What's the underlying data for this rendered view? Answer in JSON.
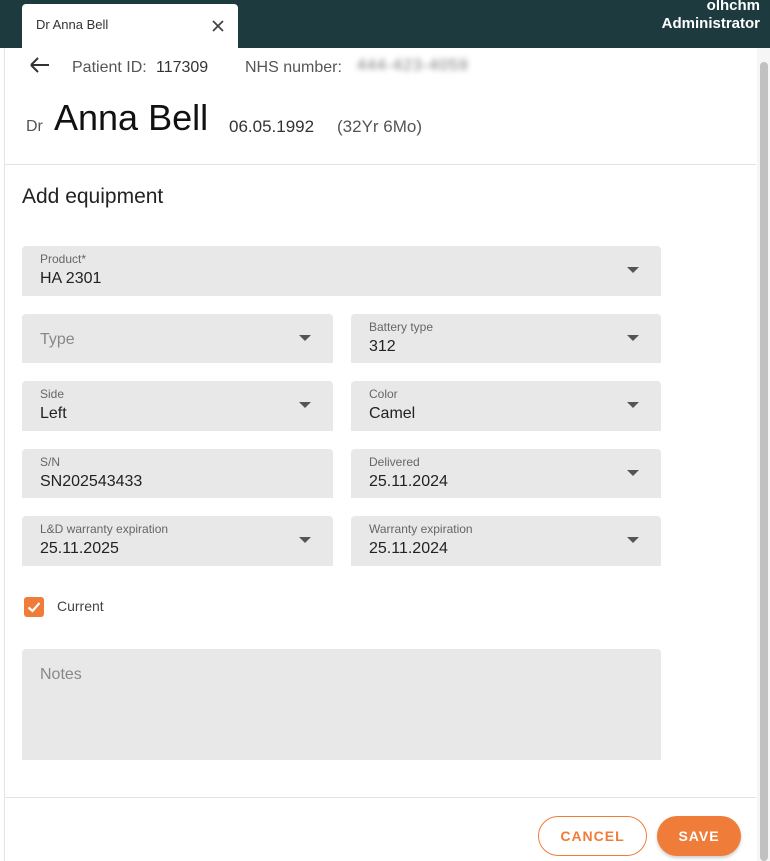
{
  "tab": {
    "label": "Dr Anna Bell"
  },
  "user": {
    "name": "olhchm",
    "role": "Administrator"
  },
  "patient": {
    "id_label": "Patient ID:",
    "id_value": "117309",
    "nhs_label": "NHS number:",
    "nhs_value": "444-423-4059",
    "prefix": "Dr",
    "name": "Anna Bell",
    "dob": "06.05.1992",
    "age": "(32Yr 6Mo)"
  },
  "form": {
    "title": "Add equipment",
    "product": {
      "label": "Product*",
      "value": "HA 2301"
    },
    "type": {
      "placeholder": "Type"
    },
    "battery_type": {
      "label": "Battery type",
      "value": "312"
    },
    "side": {
      "label": "Side",
      "value": "Left"
    },
    "color": {
      "label": "Color",
      "value": "Camel"
    },
    "sn": {
      "label": "S/N",
      "value": "SN202543433"
    },
    "delivered": {
      "label": "Delivered",
      "value": "25.11.2024"
    },
    "ld_warranty": {
      "label": "L&D warranty expiration",
      "value": "25.11.2025"
    },
    "warranty": {
      "label": "Warranty expiration",
      "value": "25.11.2024"
    },
    "current": {
      "label": "Current",
      "checked": true
    },
    "notes": {
      "placeholder": "Notes"
    }
  },
  "actions": {
    "cancel": "CANCEL",
    "save": "SAVE"
  },
  "colors": {
    "header": "#1d3a3f",
    "accent": "#f07c3a",
    "field_bg": "#e8e8e8"
  },
  "icons": {
    "back": "arrow-left-icon",
    "close": "close-icon",
    "dropdown": "chevron-down-icon",
    "check": "check-icon"
  }
}
